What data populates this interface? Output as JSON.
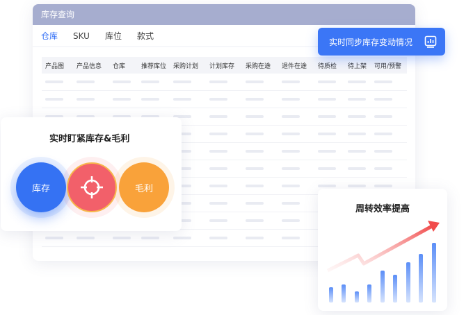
{
  "window": {
    "title": "库存查询",
    "tabs": [
      {
        "label": "仓库",
        "active": true
      },
      {
        "label": "SKU",
        "active": false
      },
      {
        "label": "库位",
        "active": false
      },
      {
        "label": "款式",
        "active": false
      }
    ]
  },
  "table": {
    "columns": [
      "产品图",
      "产品信息",
      "仓库",
      "推荐库位",
      "采购计划",
      "计划库存",
      "采购在途",
      "退件在途",
      "待质检",
      "待上架",
      "可用/预警"
    ]
  },
  "sync_badge": {
    "label": "实时同步库存变动情况",
    "icon": "chart-icon"
  },
  "monitor_card": {
    "title": "实时盯紧库存&毛利",
    "stock_label": "库存",
    "target_icon": "crosshair-icon",
    "margin_label": "毛利"
  },
  "turnover_card": {
    "title": "周转效率提高",
    "icon": "trend-arrow-icon"
  },
  "colors": {
    "accent_blue": "#3b76f6",
    "titlebar": "#a6adcf",
    "coral": "#f2606a",
    "orange": "#f9a23a"
  }
}
